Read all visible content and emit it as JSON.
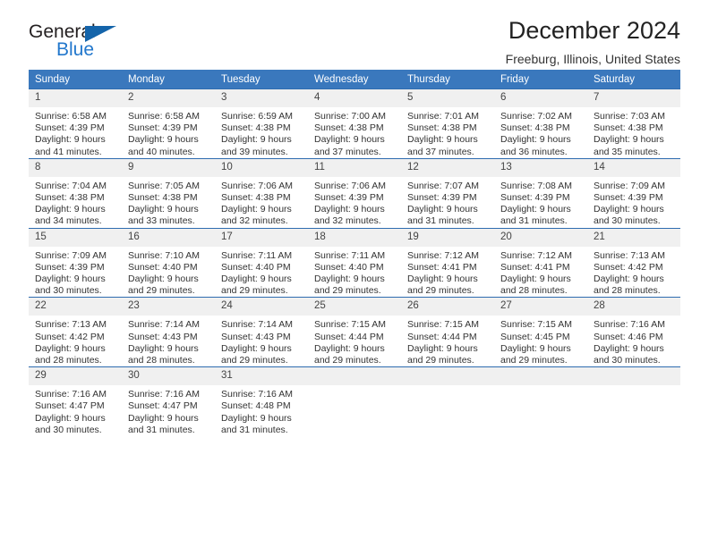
{
  "brand": {
    "name_top": "General",
    "name_bottom": "Blue",
    "triangle_color": "#1464aa",
    "blue_color": "#2277cc"
  },
  "header": {
    "title": "December 2024",
    "subtitle": "Freeburg, Illinois, United States"
  },
  "theme": {
    "header_row_bg": "#3a78bd",
    "header_row_text": "#ffffff",
    "daynum_bg": "#f0f0f0",
    "cell_border": "#2e6cb0"
  },
  "weekdays": [
    "Sunday",
    "Monday",
    "Tuesday",
    "Wednesday",
    "Thursday",
    "Friday",
    "Saturday"
  ],
  "weeks": [
    [
      {
        "day": "1",
        "sunrise": "Sunrise: 6:58 AM",
        "sunset": "Sunset: 4:39 PM",
        "daylight1": "Daylight: 9 hours",
        "daylight2": "and 41 minutes."
      },
      {
        "day": "2",
        "sunrise": "Sunrise: 6:58 AM",
        "sunset": "Sunset: 4:39 PM",
        "daylight1": "Daylight: 9 hours",
        "daylight2": "and 40 minutes."
      },
      {
        "day": "3",
        "sunrise": "Sunrise: 6:59 AM",
        "sunset": "Sunset: 4:38 PM",
        "daylight1": "Daylight: 9 hours",
        "daylight2": "and 39 minutes."
      },
      {
        "day": "4",
        "sunrise": "Sunrise: 7:00 AM",
        "sunset": "Sunset: 4:38 PM",
        "daylight1": "Daylight: 9 hours",
        "daylight2": "and 37 minutes."
      },
      {
        "day": "5",
        "sunrise": "Sunrise: 7:01 AM",
        "sunset": "Sunset: 4:38 PM",
        "daylight1": "Daylight: 9 hours",
        "daylight2": "and 37 minutes."
      },
      {
        "day": "6",
        "sunrise": "Sunrise: 7:02 AM",
        "sunset": "Sunset: 4:38 PM",
        "daylight1": "Daylight: 9 hours",
        "daylight2": "and 36 minutes."
      },
      {
        "day": "7",
        "sunrise": "Sunrise: 7:03 AM",
        "sunset": "Sunset: 4:38 PM",
        "daylight1": "Daylight: 9 hours",
        "daylight2": "and 35 minutes."
      }
    ],
    [
      {
        "day": "8",
        "sunrise": "Sunrise: 7:04 AM",
        "sunset": "Sunset: 4:38 PM",
        "daylight1": "Daylight: 9 hours",
        "daylight2": "and 34 minutes."
      },
      {
        "day": "9",
        "sunrise": "Sunrise: 7:05 AM",
        "sunset": "Sunset: 4:38 PM",
        "daylight1": "Daylight: 9 hours",
        "daylight2": "and 33 minutes."
      },
      {
        "day": "10",
        "sunrise": "Sunrise: 7:06 AM",
        "sunset": "Sunset: 4:38 PM",
        "daylight1": "Daylight: 9 hours",
        "daylight2": "and 32 minutes."
      },
      {
        "day": "11",
        "sunrise": "Sunrise: 7:06 AM",
        "sunset": "Sunset: 4:39 PM",
        "daylight1": "Daylight: 9 hours",
        "daylight2": "and 32 minutes."
      },
      {
        "day": "12",
        "sunrise": "Sunrise: 7:07 AM",
        "sunset": "Sunset: 4:39 PM",
        "daylight1": "Daylight: 9 hours",
        "daylight2": "and 31 minutes."
      },
      {
        "day": "13",
        "sunrise": "Sunrise: 7:08 AM",
        "sunset": "Sunset: 4:39 PM",
        "daylight1": "Daylight: 9 hours",
        "daylight2": "and 31 minutes."
      },
      {
        "day": "14",
        "sunrise": "Sunrise: 7:09 AM",
        "sunset": "Sunset: 4:39 PM",
        "daylight1": "Daylight: 9 hours",
        "daylight2": "and 30 minutes."
      }
    ],
    [
      {
        "day": "15",
        "sunrise": "Sunrise: 7:09 AM",
        "sunset": "Sunset: 4:39 PM",
        "daylight1": "Daylight: 9 hours",
        "daylight2": "and 30 minutes."
      },
      {
        "day": "16",
        "sunrise": "Sunrise: 7:10 AM",
        "sunset": "Sunset: 4:40 PM",
        "daylight1": "Daylight: 9 hours",
        "daylight2": "and 29 minutes."
      },
      {
        "day": "17",
        "sunrise": "Sunrise: 7:11 AM",
        "sunset": "Sunset: 4:40 PM",
        "daylight1": "Daylight: 9 hours",
        "daylight2": "and 29 minutes."
      },
      {
        "day": "18",
        "sunrise": "Sunrise: 7:11 AM",
        "sunset": "Sunset: 4:40 PM",
        "daylight1": "Daylight: 9 hours",
        "daylight2": "and 29 minutes."
      },
      {
        "day": "19",
        "sunrise": "Sunrise: 7:12 AM",
        "sunset": "Sunset: 4:41 PM",
        "daylight1": "Daylight: 9 hours",
        "daylight2": "and 29 minutes."
      },
      {
        "day": "20",
        "sunrise": "Sunrise: 7:12 AM",
        "sunset": "Sunset: 4:41 PM",
        "daylight1": "Daylight: 9 hours",
        "daylight2": "and 28 minutes."
      },
      {
        "day": "21",
        "sunrise": "Sunrise: 7:13 AM",
        "sunset": "Sunset: 4:42 PM",
        "daylight1": "Daylight: 9 hours",
        "daylight2": "and 28 minutes."
      }
    ],
    [
      {
        "day": "22",
        "sunrise": "Sunrise: 7:13 AM",
        "sunset": "Sunset: 4:42 PM",
        "daylight1": "Daylight: 9 hours",
        "daylight2": "and 28 minutes."
      },
      {
        "day": "23",
        "sunrise": "Sunrise: 7:14 AM",
        "sunset": "Sunset: 4:43 PM",
        "daylight1": "Daylight: 9 hours",
        "daylight2": "and 28 minutes."
      },
      {
        "day": "24",
        "sunrise": "Sunrise: 7:14 AM",
        "sunset": "Sunset: 4:43 PM",
        "daylight1": "Daylight: 9 hours",
        "daylight2": "and 29 minutes."
      },
      {
        "day": "25",
        "sunrise": "Sunrise: 7:15 AM",
        "sunset": "Sunset: 4:44 PM",
        "daylight1": "Daylight: 9 hours",
        "daylight2": "and 29 minutes."
      },
      {
        "day": "26",
        "sunrise": "Sunrise: 7:15 AM",
        "sunset": "Sunset: 4:44 PM",
        "daylight1": "Daylight: 9 hours",
        "daylight2": "and 29 minutes."
      },
      {
        "day": "27",
        "sunrise": "Sunrise: 7:15 AM",
        "sunset": "Sunset: 4:45 PM",
        "daylight1": "Daylight: 9 hours",
        "daylight2": "and 29 minutes."
      },
      {
        "day": "28",
        "sunrise": "Sunrise: 7:16 AM",
        "sunset": "Sunset: 4:46 PM",
        "daylight1": "Daylight: 9 hours",
        "daylight2": "and 30 minutes."
      }
    ],
    [
      {
        "day": "29",
        "sunrise": "Sunrise: 7:16 AM",
        "sunset": "Sunset: 4:47 PM",
        "daylight1": "Daylight: 9 hours",
        "daylight2": "and 30 minutes."
      },
      {
        "day": "30",
        "sunrise": "Sunrise: 7:16 AM",
        "sunset": "Sunset: 4:47 PM",
        "daylight1": "Daylight: 9 hours",
        "daylight2": "and 31 minutes."
      },
      {
        "day": "31",
        "sunrise": "Sunrise: 7:16 AM",
        "sunset": "Sunset: 4:48 PM",
        "daylight1": "Daylight: 9 hours",
        "daylight2": "and 31 minutes."
      },
      {
        "day": "",
        "sunrise": "",
        "sunset": "",
        "daylight1": "",
        "daylight2": ""
      },
      {
        "day": "",
        "sunrise": "",
        "sunset": "",
        "daylight1": "",
        "daylight2": ""
      },
      {
        "day": "",
        "sunrise": "",
        "sunset": "",
        "daylight1": "",
        "daylight2": ""
      },
      {
        "day": "",
        "sunrise": "",
        "sunset": "",
        "daylight1": "",
        "daylight2": ""
      }
    ]
  ]
}
